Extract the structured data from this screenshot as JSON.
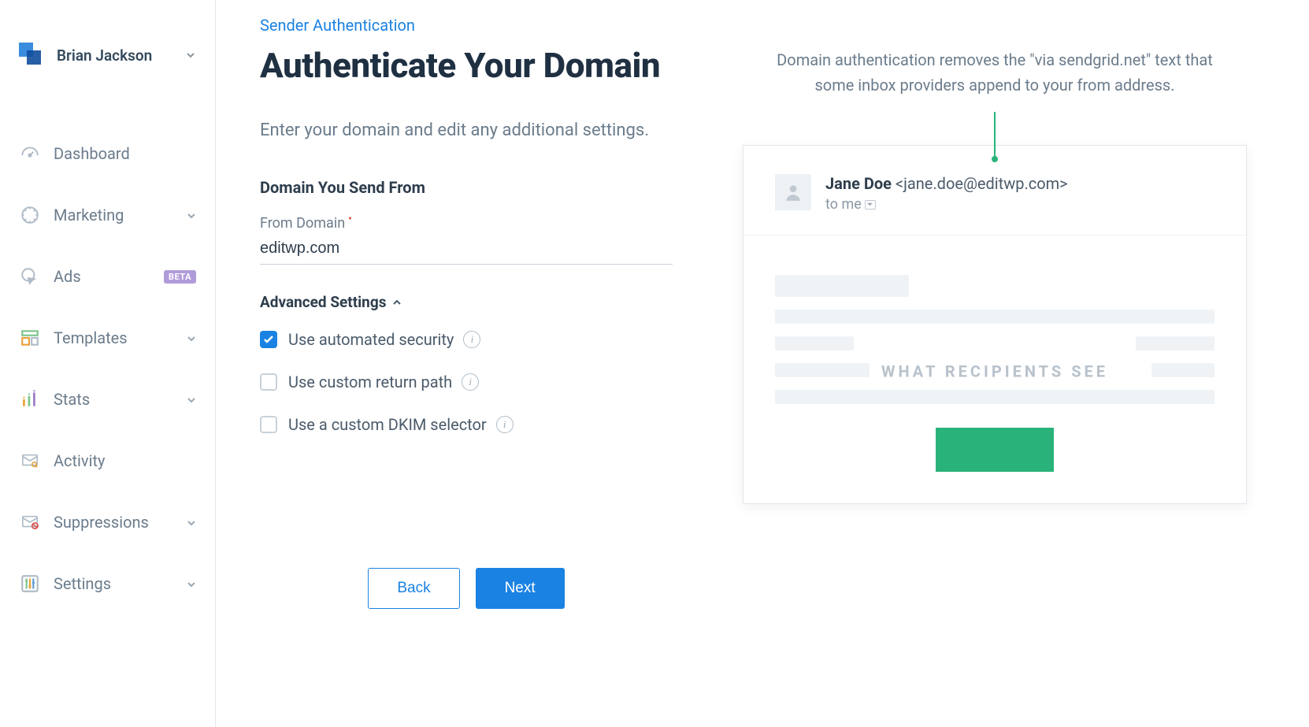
{
  "user": {
    "name": "Brian Jackson"
  },
  "sidebar": {
    "items": [
      {
        "label": "Dashboard",
        "icon": "gauge",
        "expandable": false
      },
      {
        "label": "Marketing",
        "icon": "megaphone",
        "expandable": true
      },
      {
        "label": "Ads",
        "icon": "cursor-click",
        "badge": "BETA",
        "expandable": false
      },
      {
        "label": "Templates",
        "icon": "layout",
        "expandable": true
      },
      {
        "label": "Stats",
        "icon": "bar-chart",
        "expandable": true
      },
      {
        "label": "Activity",
        "icon": "mail-search",
        "expandable": false
      },
      {
        "label": "Suppressions",
        "icon": "mail-block",
        "expandable": true
      },
      {
        "label": "Settings",
        "icon": "sliders",
        "expandable": true
      }
    ]
  },
  "breadcrumb": "Sender Authentication",
  "title": "Authenticate Your Domain",
  "instruction": "Enter your domain and edit any additional settings.",
  "form": {
    "section_label": "Domain You Send From",
    "from_domain_label": "From Domain",
    "from_domain_value": "editwp.com",
    "advanced_label": "Advanced Settings",
    "options": [
      {
        "label": "Use automated security",
        "checked": true,
        "info": true
      },
      {
        "label": "Use custom return path",
        "checked": false,
        "info": true
      },
      {
        "label": "Use a custom DKIM selector",
        "checked": false,
        "info": true
      }
    ],
    "back_label": "Back",
    "next_label": "Next"
  },
  "preview": {
    "description": "Domain authentication removes the \"via sendgrid.net\" text that some inbox providers append to your from address.",
    "sender_name": "Jane Doe",
    "sender_email": "<jane.doe@editwp.com>",
    "to_line": "to me",
    "watermark": "WHAT RECIPIENTS SEE"
  }
}
